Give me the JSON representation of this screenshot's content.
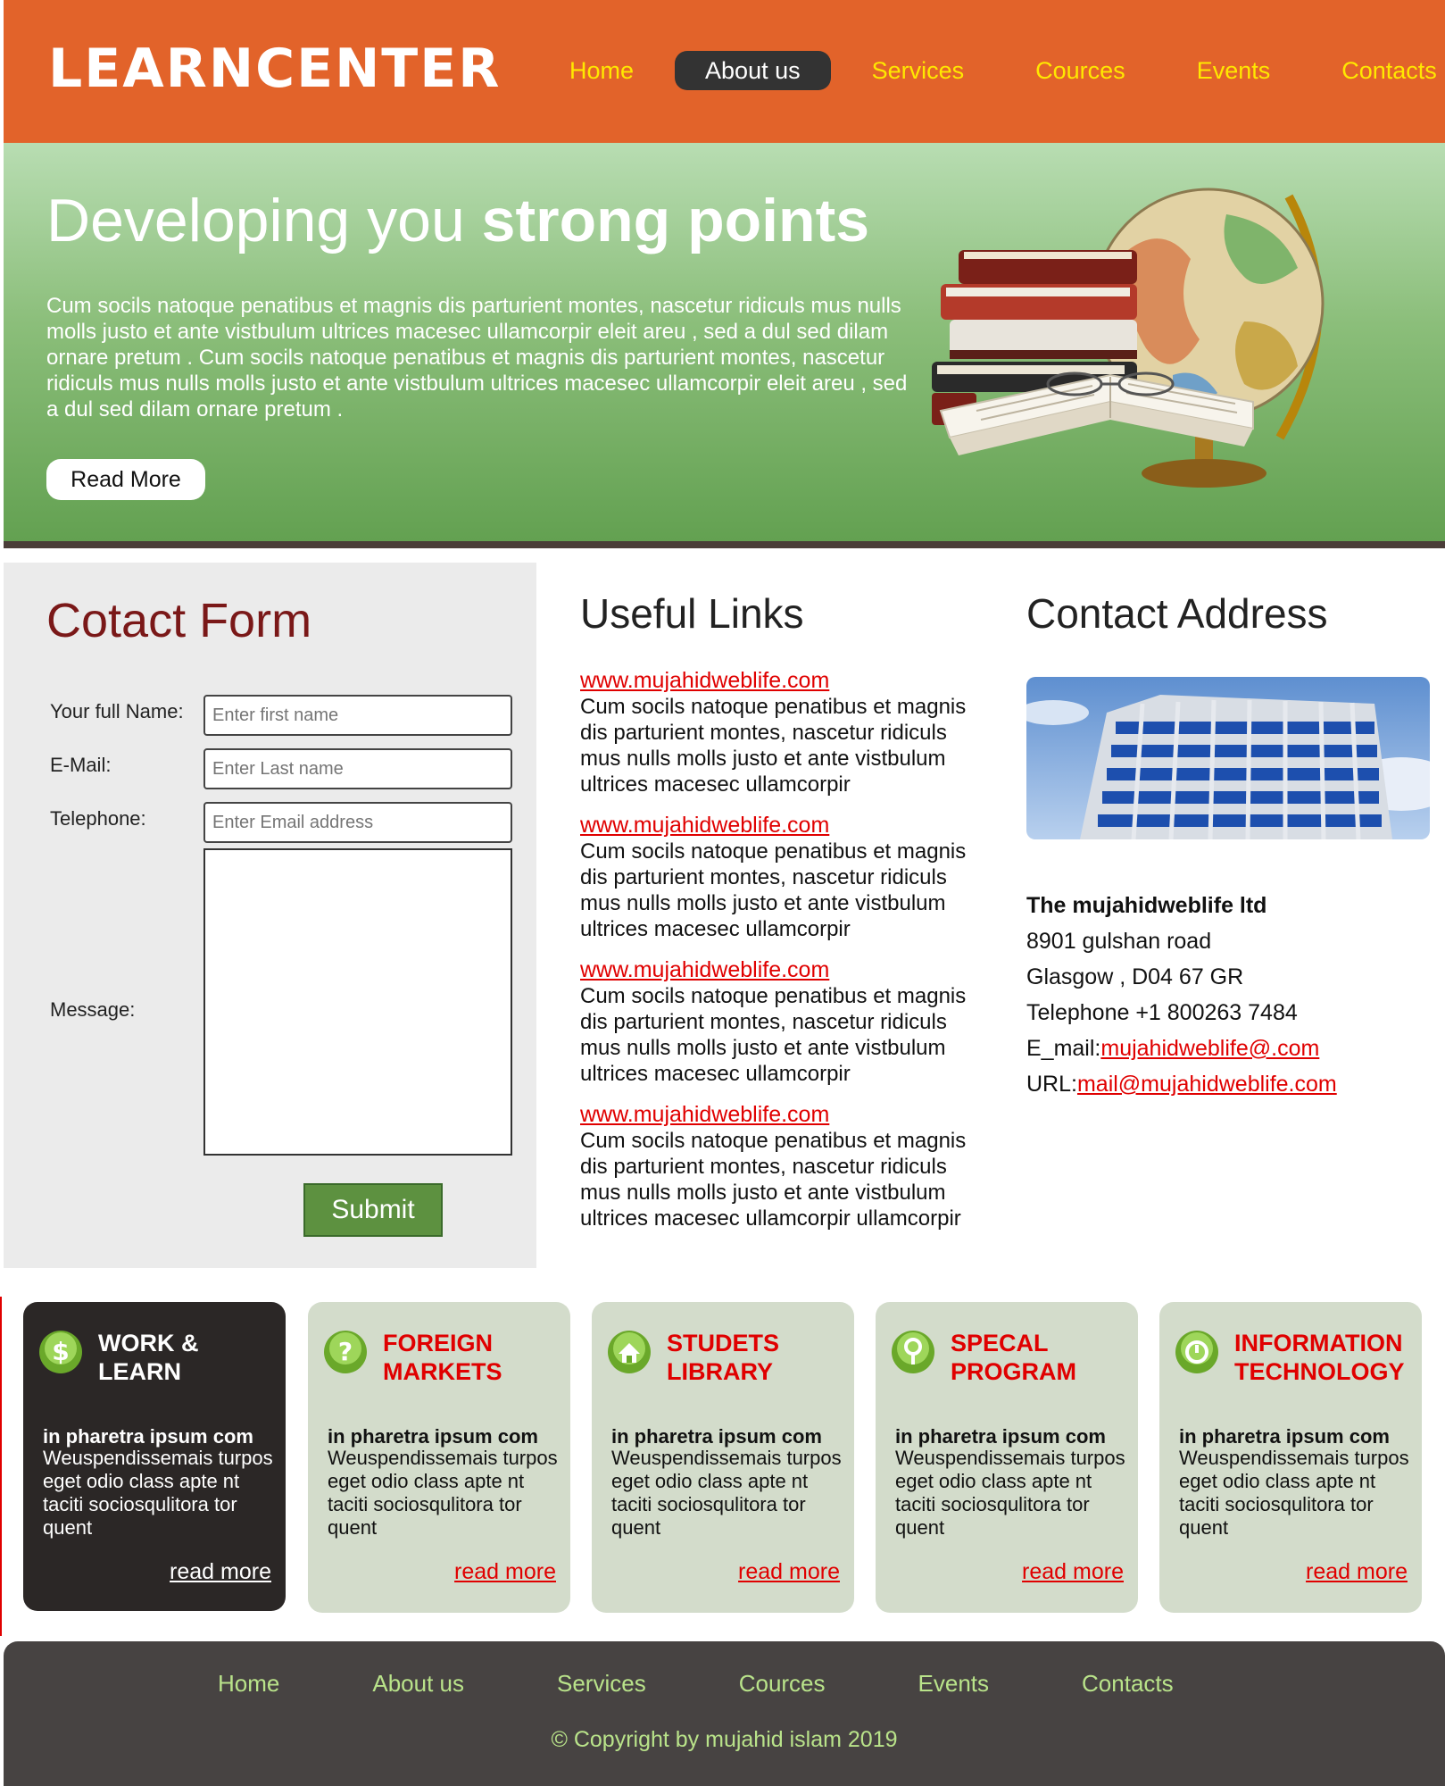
{
  "header": {
    "logo": "LEARNCENTER",
    "nav": [
      "Home",
      "About us",
      "Services",
      "Cources",
      "Events",
      "Contacts"
    ],
    "active_nav": "About us"
  },
  "hero": {
    "title_regular": "Developing you ",
    "title_bold": "strong points",
    "text": "Cum socils natoque penatibus et magnis dis parturient montes, nascetur ridiculs mus nulls molls justo et ante vistbulum ultrices macesec ullamcorpir eleit areu , sed a dul sed dilam ornare pretum . Cum socils natoque penatibus et magnis dis parturient montes, nascetur ridiculs mus nulls molls justo et ante vistbulum ultrices macesec ullamcorpir eleit areu , sed a dul sed dilam ornare pretum .",
    "button": "Read More"
  },
  "contact_form": {
    "title": "Cotact Form",
    "labels": {
      "name": "Your full Name:",
      "email": "E-Mail:",
      "phone": "Telephone:",
      "message": "Message:"
    },
    "placeholders": {
      "name": "Enter first name",
      "email": "Enter Last name",
      "phone": "Enter Email address"
    },
    "submit": "Submit"
  },
  "useful_links": {
    "title": "Useful Links",
    "items": [
      {
        "url": "www.mujahidweblife.com",
        "text": "Cum socils natoque penatibus et magnis dis parturient montes, nascetur ridiculs mus nulls molls justo et ante vistbulum ultrices macesec ullamcorpir"
      },
      {
        "url": "www.mujahidweblife.com",
        "text": "Cum socils natoque penatibus et magnis dis parturient montes, nascetur ridiculs mus nulls molls justo et ante vistbulum ultrices macesec ullamcorpir"
      },
      {
        "url": "www.mujahidweblife.com",
        "text": "Cum socils natoque penatibus et magnis dis parturient montes, nascetur ridiculs mus nulls molls justo et ante vistbulum ultrices macesec ullamcorpir"
      },
      {
        "url": "www.mujahidweblife.com",
        "text": "Cum socils natoque penatibus et magnis dis parturient montes, nascetur ridiculs mus nulls molls justo et ante vistbulum ultrices macesec ullamcorpir ullamcorpir"
      }
    ]
  },
  "contact_address": {
    "title": "Contact Address",
    "company": "The mujahidweblife ltd",
    "street": "8901 gulshan road",
    "city": "Glasgow , D04 67 GR",
    "telephone": "Telephone +1 800263 7484",
    "email_label": "E_mail:",
    "email": "mujahidweblife@.com",
    "url_label": "URL:",
    "url": "mail@mujahidweblife.com"
  },
  "cards": [
    {
      "title": "WORK & LEARN",
      "icon": "dollar-icon",
      "lead": "in pharetra ipsum com",
      "body": "Weuspendissemais turpos eget odio class apte nt taciti sociosqulitora tor quent",
      "more": "read more"
    },
    {
      "title": "FOREIGN MARKETS",
      "icon": "question-icon",
      "lead": "in pharetra ipsum com",
      "body": "Weuspendissemais turpos eget odio class apte nt taciti sociosqulitora tor quent",
      "more": "read more"
    },
    {
      "title": "STUDETS LIBRARY",
      "icon": "home-icon",
      "lead": "in pharetra ipsum com",
      "body": "Weuspendissemais turpos eget odio class apte nt taciti sociosqulitora tor quent",
      "more": "read more"
    },
    {
      "title": "SPECAL PROGRAM",
      "icon": "pin-icon",
      "lead": "in pharetra ipsum com",
      "body": "Weuspendissemais turpos eget odio class apte nt taciti sociosqulitora tor quent",
      "more": "read more"
    },
    {
      "title": "INFORMATION TECHNOLOGY",
      "icon": "info-icon",
      "lead": "in pharetra ipsum com",
      "body": "Weuspendissemais turpos eget odio class apte nt taciti sociosqulitora tor quent",
      "more": "read more"
    }
  ],
  "footer": {
    "nav": [
      "Home",
      "About us",
      "Services",
      "Cources",
      "Events",
      "Contacts"
    ],
    "copyright": "© Copyright by mujahid islam 2019"
  },
  "colors": {
    "header": "#e2632a",
    "nav_text": "#ffe800",
    "accent_red": "#e00000",
    "card_bg": "#d3dccb",
    "card_dark": "#2b2726",
    "footer_bg": "#474342",
    "footer_text": "#b9e38a",
    "submit": "#5d9140"
  }
}
